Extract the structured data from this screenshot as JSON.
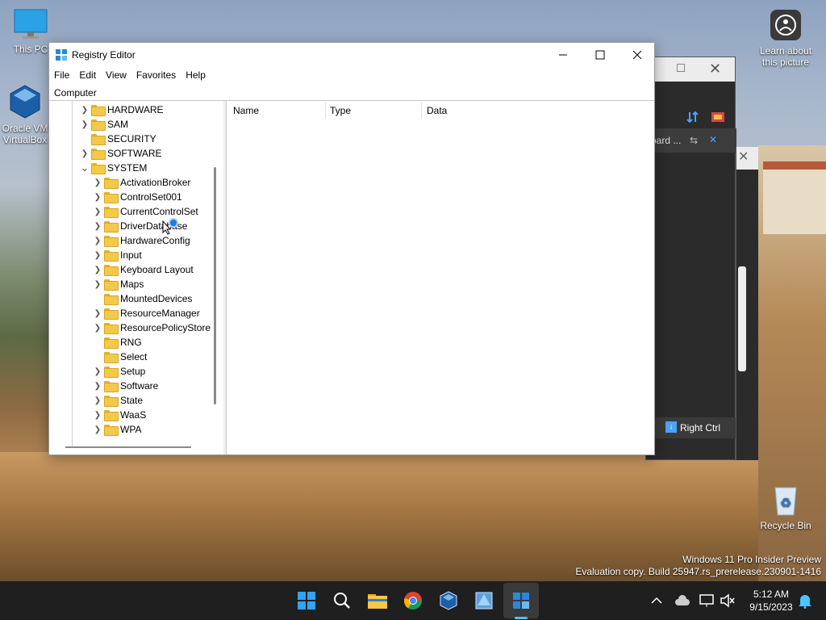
{
  "desktop": {
    "icons": [
      {
        "label": "This PC"
      },
      {
        "label": "Oracle VM VirtualBox"
      },
      {
        "label": "Learn about this picture"
      },
      {
        "label": "Recycle Bin"
      }
    ],
    "watermark_line1": "Windows 11 Pro Insider Preview",
    "watermark_line2": "Evaluation copy. Build 25947.rs_prerelease.230901-1416"
  },
  "background_window": {
    "tab_text": "oard ...",
    "status_text": "Right Ctrl"
  },
  "regedit": {
    "title": "Registry Editor",
    "menu": [
      "File",
      "Edit",
      "View",
      "Favorites",
      "Help"
    ],
    "address": "Computer",
    "columns": [
      "Name",
      "Type",
      "Data"
    ],
    "tree": [
      {
        "label": "HARDWARE",
        "expander": "collapsed"
      },
      {
        "label": "SAM",
        "expander": "collapsed"
      },
      {
        "label": "SECURITY",
        "expander": "none"
      },
      {
        "label": "SOFTWARE",
        "expander": "collapsed"
      },
      {
        "label": "SYSTEM",
        "expander": "expanded"
      },
      {
        "label": "ActivationBroker",
        "expander": "collapsed"
      },
      {
        "label": "ControlSet001",
        "expander": "collapsed"
      },
      {
        "label": "CurrentControlSet",
        "expander": "collapsed"
      },
      {
        "label": "DriverDatabase",
        "expander": "collapsed"
      },
      {
        "label": "HardwareConfig",
        "expander": "collapsed"
      },
      {
        "label": "Input",
        "expander": "collapsed"
      },
      {
        "label": "Keyboard Layout",
        "expander": "collapsed"
      },
      {
        "label": "Maps",
        "expander": "collapsed"
      },
      {
        "label": "MountedDevices",
        "expander": "none"
      },
      {
        "label": "ResourceManager",
        "expander": "collapsed"
      },
      {
        "label": "ResourcePolicyStore",
        "expander": "collapsed"
      },
      {
        "label": "RNG",
        "expander": "none"
      },
      {
        "label": "Select",
        "expander": "none"
      },
      {
        "label": "Setup",
        "expander": "collapsed"
      },
      {
        "label": "Software",
        "expander": "collapsed"
      },
      {
        "label": "State",
        "expander": "collapsed"
      },
      {
        "label": "WaaS",
        "expander": "collapsed"
      },
      {
        "label": "WPA",
        "expander": "collapsed"
      }
    ]
  },
  "taskbar": {
    "apps": [
      "start-icon",
      "search-icon",
      "file-explorer-icon",
      "chrome-icon",
      "virtualbox-icon",
      "vmware-icon",
      "regedit-icon"
    ],
    "time": "5:12 AM",
    "date": "9/15/2023"
  }
}
